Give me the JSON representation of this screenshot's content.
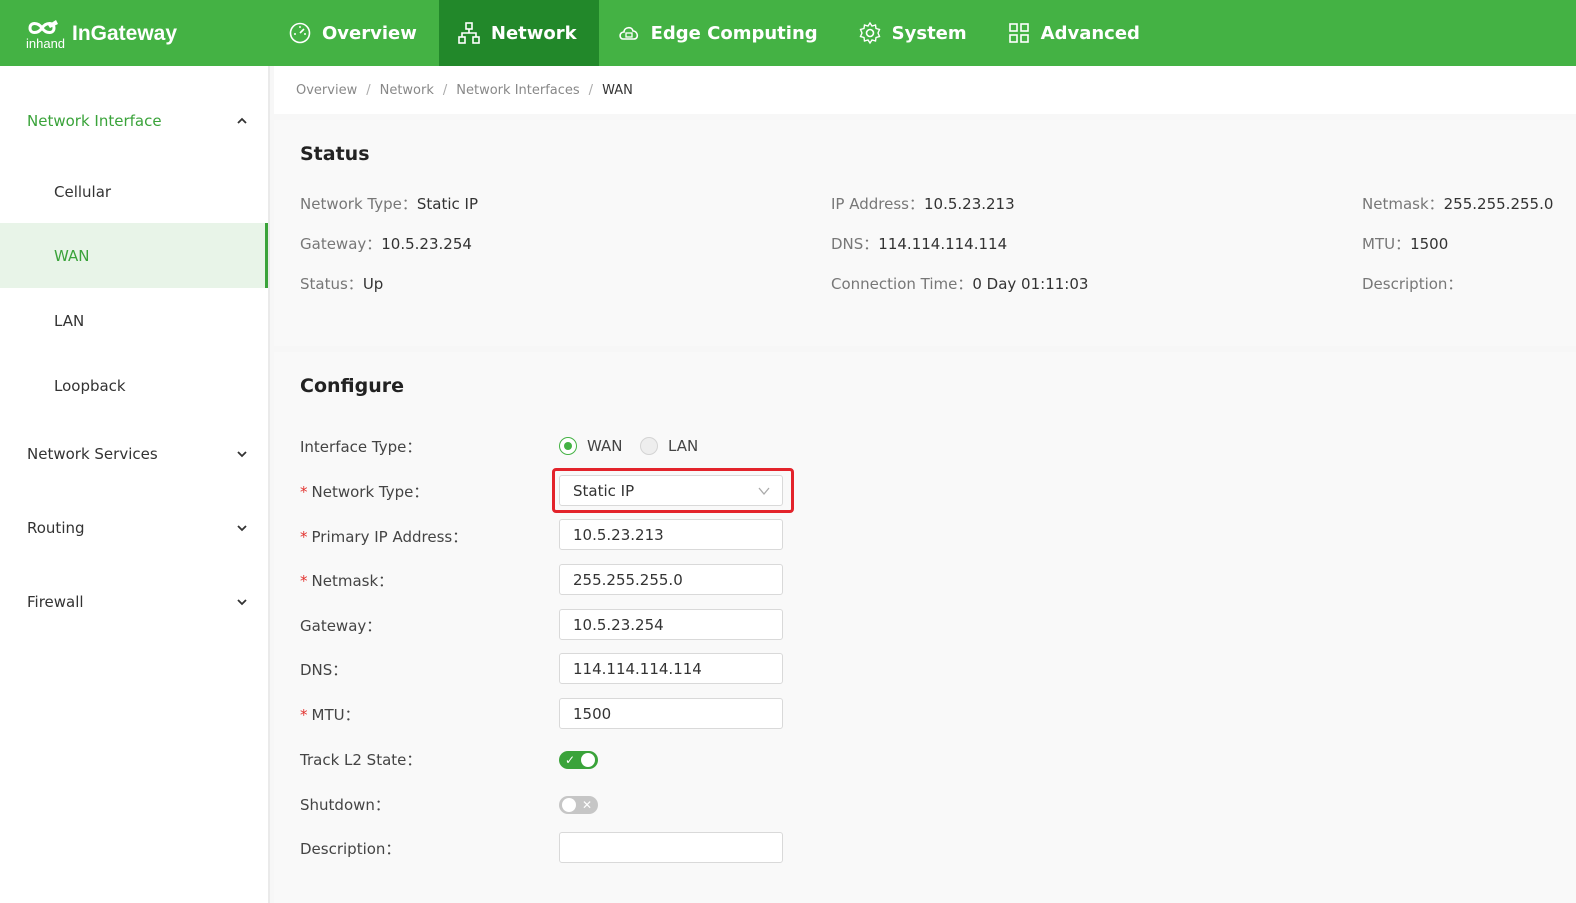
{
  "app": {
    "logo_text": "InGateway",
    "logo_subtext": "inhand"
  },
  "nav": [
    {
      "label": "Overview",
      "icon": "dashboard-icon",
      "active": false
    },
    {
      "label": "Network",
      "icon": "network-icon",
      "active": true
    },
    {
      "label": "Edge Computing",
      "icon": "cloud-icon",
      "active": false
    },
    {
      "label": "System",
      "icon": "gear-icon",
      "active": false
    },
    {
      "label": "Advanced",
      "icon": "grid-icon",
      "active": false
    }
  ],
  "sidebar": {
    "groups": [
      {
        "label": "Network Interface",
        "expanded": true,
        "items": [
          "Cellular",
          "WAN",
          "LAN",
          "Loopback"
        ],
        "active_item": "WAN"
      },
      {
        "label": "Network Services",
        "expanded": false
      },
      {
        "label": "Routing",
        "expanded": false
      },
      {
        "label": "Firewall",
        "expanded": false
      }
    ]
  },
  "breadcrumb": [
    "Overview",
    "Network",
    "Network Interfaces",
    "WAN"
  ],
  "status": {
    "title": "Status",
    "fields": [
      {
        "label": "Network Type：",
        "value": "Static IP"
      },
      {
        "label": "IP Address：",
        "value": "10.5.23.213"
      },
      {
        "label": "Netmask：",
        "value": "255.255.255.0"
      },
      {
        "label": "Gateway：",
        "value": "10.5.23.254"
      },
      {
        "label": "DNS：",
        "value": "114.114.114.114"
      },
      {
        "label": "MTU：",
        "value": "1500"
      },
      {
        "label": "Status：",
        "value": "Up"
      },
      {
        "label": "Connection Time：",
        "value": "0 Day 01:11:03"
      },
      {
        "label": "Description：",
        "value": ""
      }
    ]
  },
  "configure": {
    "title": "Configure",
    "interface_type": {
      "label": "Interface Type：",
      "options": [
        "WAN",
        "LAN"
      ],
      "selected": "WAN"
    },
    "network_type": {
      "label": "Network Type：",
      "value": "Static IP",
      "required": true
    },
    "primary_ip": {
      "label": "Primary IP Address：",
      "value": "10.5.23.213",
      "required": true
    },
    "netmask": {
      "label": "Netmask：",
      "value": "255.255.255.0",
      "required": true
    },
    "gateway": {
      "label": "Gateway：",
      "value": "10.5.23.254"
    },
    "dns": {
      "label": "DNS：",
      "value": "114.114.114.114"
    },
    "mtu": {
      "label": "MTU：",
      "value": "1500",
      "required": true
    },
    "track_l2": {
      "label": "Track L2 State：",
      "on": true,
      "glyph": "✓"
    },
    "shutdown": {
      "label": "Shutdown：",
      "on": false,
      "glyph": "✕"
    },
    "description": {
      "label": "Description：",
      "value": ""
    },
    "required_mark": "*"
  },
  "colors": {
    "brand": "#44b244",
    "nav_active": "#22882a",
    "highlight": "#e3232b",
    "required": "#e2332f"
  }
}
